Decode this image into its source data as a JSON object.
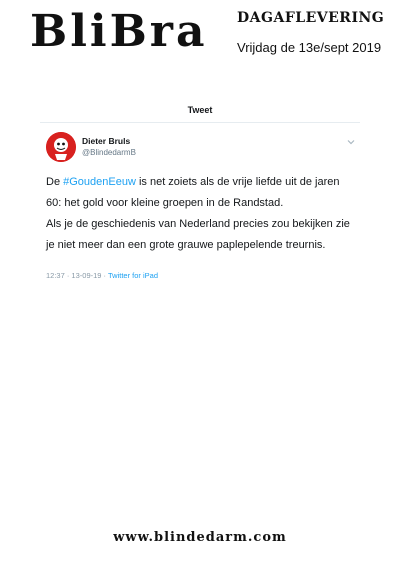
{
  "masthead": {
    "brand": "BliBra",
    "edition": "DAGAFLEVERING",
    "date": "Vrijdag de 13e/sept 2019"
  },
  "tweet": {
    "header": "Tweet",
    "author_name": "Dieter Bruls",
    "author_handle": "@BlindedarmB",
    "p1_before": "De ",
    "hashtag": "#GoudenEeuw",
    "p1_after": " is net zoiets als de vrije liefde uit de jaren 60: het gold voor kleine groepen in de Randstad.",
    "p2": "Als je de geschiedenis van Nederland precies zou bekijken zie je niet meer dan een grote grauwe paplepelende treurnis.",
    "timestamp": "12:37 · 13-09-19 · ",
    "source": "Twitter for iPad",
    "colors": {
      "link": "#1da1f2",
      "avatar_bg": "#d8211f"
    },
    "icons": {
      "menu": "chevron-down-icon"
    }
  },
  "footer": {
    "url": "www.blindedarm.com"
  }
}
